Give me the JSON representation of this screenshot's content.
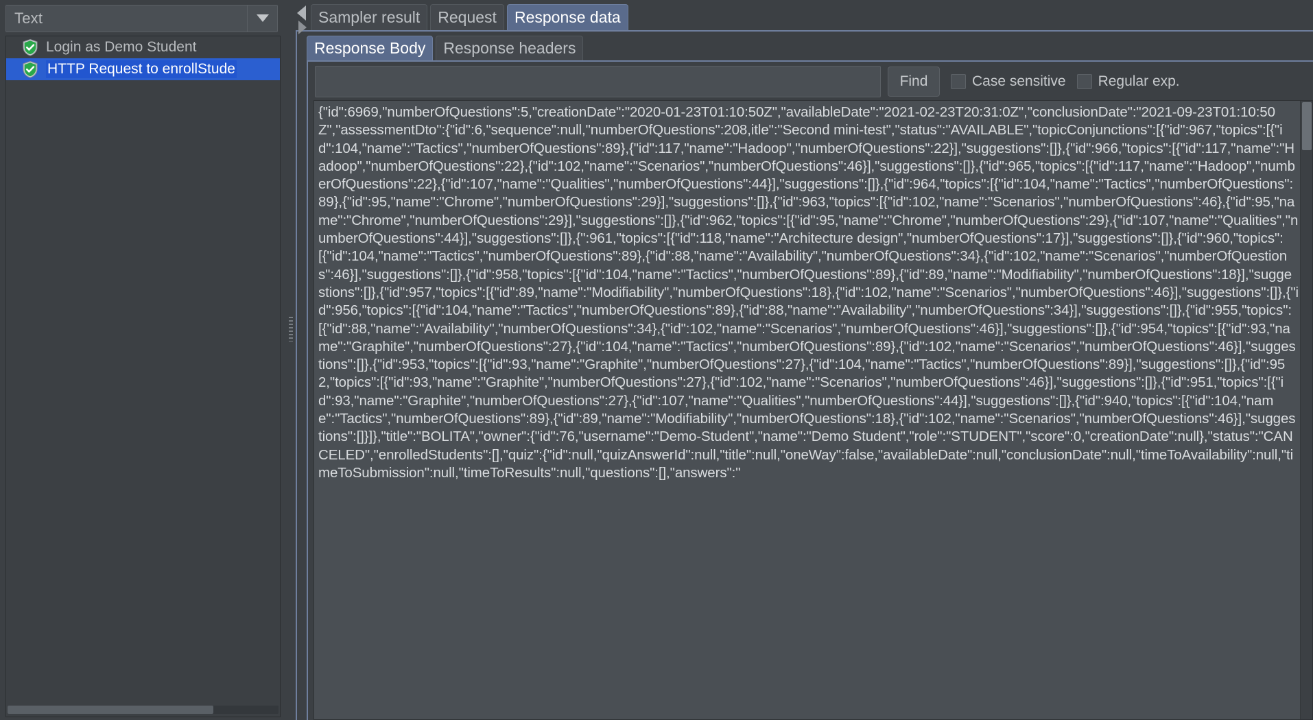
{
  "left_panel": {
    "renderer_combo": {
      "value": "Text",
      "icon": "chevron-down-icon"
    },
    "tree_items": [
      {
        "label": "Login as Demo Student",
        "icon": "shield-check-icon",
        "selected": false
      },
      {
        "label": "HTTP Request to enrollStude",
        "icon": "shield-check-icon",
        "selected": true
      }
    ]
  },
  "right_panel": {
    "tabs": [
      {
        "label": "Sampler result",
        "active": false
      },
      {
        "label": "Request",
        "active": false
      },
      {
        "label": "Response data",
        "active": true
      }
    ],
    "subtabs": [
      {
        "label": "Response Body",
        "active": true
      },
      {
        "label": "Response headers",
        "active": false
      }
    ],
    "search": {
      "value": "",
      "placeholder": "",
      "find_label": "Find",
      "case_sensitive_label": "Case sensitive",
      "regular_exp_label": "Regular exp."
    },
    "response_body": "{\"id\":6969,\"numberOfQuestions\":5,\"creationDate\":\"2020-01-23T01:10:50Z\",\"availableDate\":\"2021-02-23T20:31:0Z\",\"conclusionDate\":\"2021-09-23T01:10:50Z\",\"assessmentDto\":{\"id\":6,\"sequence\":null,\"numberOfQuestions\":208,itle\":\"Second mini-test\",\"status\":\"AVAILABLE\",\"topicConjunctions\":[{\"id\":967,\"topics\":[{\"id\":104,\"name\":\"Tactics\",\"numberOfQuestions\":89},{\"id\":117,\"name\":\"Hadoop\",\"numberOfQuestions\":22}],\"suggestions\":[]},{\"id\":966,\"topics\":[{\"id\":117,\"name\":\"Hadoop\",\"numberOfQuestions\":22},{\"id\":102,\"name\":\"Scenarios\",\"numberOfQuestions\":46}],\"suggestions\":[]},{\"id\":965,\"topics\":[{\"id\":117,\"name\":\"Hadoop\",\"numberOfQuestions\":22},{\"id\":107,\"name\":\"Qualities\",\"numberOfQuestions\":44}],\"suggestions\":[]},{\"id\":964,\"topics\":[{\"id\":104,\"name\":\"Tactics\",\"numberOfQuestions\":89},{\"id\":95,\"name\":\"Chrome\",\"numberOfQuestions\":29}],\"suggestions\":[]},{\"id\":963,\"topics\":[{\"id\":102,\"name\":\"Scenarios\",\"numberOfQuestions\":46},{\"id\":95,\"name\":\"Chrome\",\"numberOfQuestions\":29}],\"suggestions\":[]},{\"id\":962,\"topics\":[{\"id\":95,\"name\":\"Chrome\",\"numberOfQuestions\":29},{\"id\":107,\"name\":\"Qualities\",\"numberOfQuestions\":44}],\"suggestions\":[]},{\":961,\"topics\":[{\"id\":118,\"name\":\"Architecture design\",\"numberOfQuestions\":17}],\"suggestions\":[]},{\"id\":960,\"topics\":[{\"id\":104,\"name\":\"Tactics\",\"numberOfQuestions\":89},{\"id\":88,\"name\":\"Availability\",\"numberOfQuestions\":34},{\"id\":102,\"name\":\"Scenarios\",\"numberOfQuestions\":46}],\"suggestions\":[]},{\"id\":958,\"topics\":[{\"id\":104,\"name\":\"Tactics\",\"numberOfQuestions\":89},{\"id\":89,\"name\":\"Modifiability\",\"numberOfQuestions\":18}],\"suggestions\":[]},{\"id\":957,\"topics\":[{\"id\":89,\"name\":\"Modifiability\",\"numberOfQuestions\":18},{\"id\":102,\"name\":\"Scenarios\",\"numberOfQuestions\":46}],\"suggestions\":[]},{\"id\":956,\"topics\":[{\"id\":104,\"name\":\"Tactics\",\"numberOfQuestions\":89},{\"id\":88,\"name\":\"Availability\",\"numberOfQuestions\":34}],\"suggestions\":[]},{\"id\":955,\"topics\":[{\"id\":88,\"name\":\"Availability\",\"numberOfQuestions\":34},{\"id\":102,\"name\":\"Scenarios\",\"numberOfQuestions\":46}],\"suggestions\":[]},{\"id\":954,\"topics\":[{\"id\":93,\"name\":\"Graphite\",\"numberOfQuestions\":27},{\"id\":104,\"name\":\"Tactics\",\"numberOfQuestions\":89},{\"id\":102,\"name\":\"Scenarios\",\"numberOfQuestions\":46}],\"suggestions\":[]},{\"id\":953,\"topics\":[{\"id\":93,\"name\":\"Graphite\",\"numberOfQuestions\":27},{\"id\":104,\"name\":\"Tactics\",\"numberOfQuestions\":89}],\"suggestions\":[]},{\"id\":952,\"topics\":[{\"id\":93,\"name\":\"Graphite\",\"numberOfQuestions\":27},{\"id\":102,\"name\":\"Scenarios\",\"numberOfQuestions\":46}],\"suggestions\":[]},{\"id\":951,\"topics\":[{\"id\":93,\"name\":\"Graphite\",\"numberOfQuestions\":27},{\"id\":107,\"name\":\"Qualities\",\"numberOfQuestions\":44}],\"suggestions\":[]},{\"id\":940,\"topics\":[{\"id\":104,\"name\":\"Tactics\",\"numberOfQuestions\":89},{\"id\":89,\"name\":\"Modifiability\",\"numberOfQuestions\":18},{\"id\":102,\"name\":\"Scenarios\",\"numberOfQuestions\":46}],\"suggestions\":[]}]},\"title\":\"BOLITA\",\"owner\":{\"id\":76,\"username\":\"Demo-Student\",\"name\":\"Demo Student\",\"role\":\"STUDENT\",\"score\":0,\"creationDate\":null},\"status\":\"CANCELED\",\"enrolledStudents\":[],\"quiz\":{\"id\":null,\"quizAnswerId\":null,\"title\":null,\"oneWay\":false,\"availableDate\":null,\"conclusionDate\":null,\"timeToAvailability\":null,\"timeToSubmission\":null,\"timeToResults\":null,\"questions\":[],\"answers\":\""
  },
  "colors": {
    "window_bg": "#3c4044",
    "field_bg": "#4a4f54",
    "selection_blue": "#2b5fd0",
    "active_tab": "#5a6b8c",
    "text": "#c6c9cc"
  }
}
